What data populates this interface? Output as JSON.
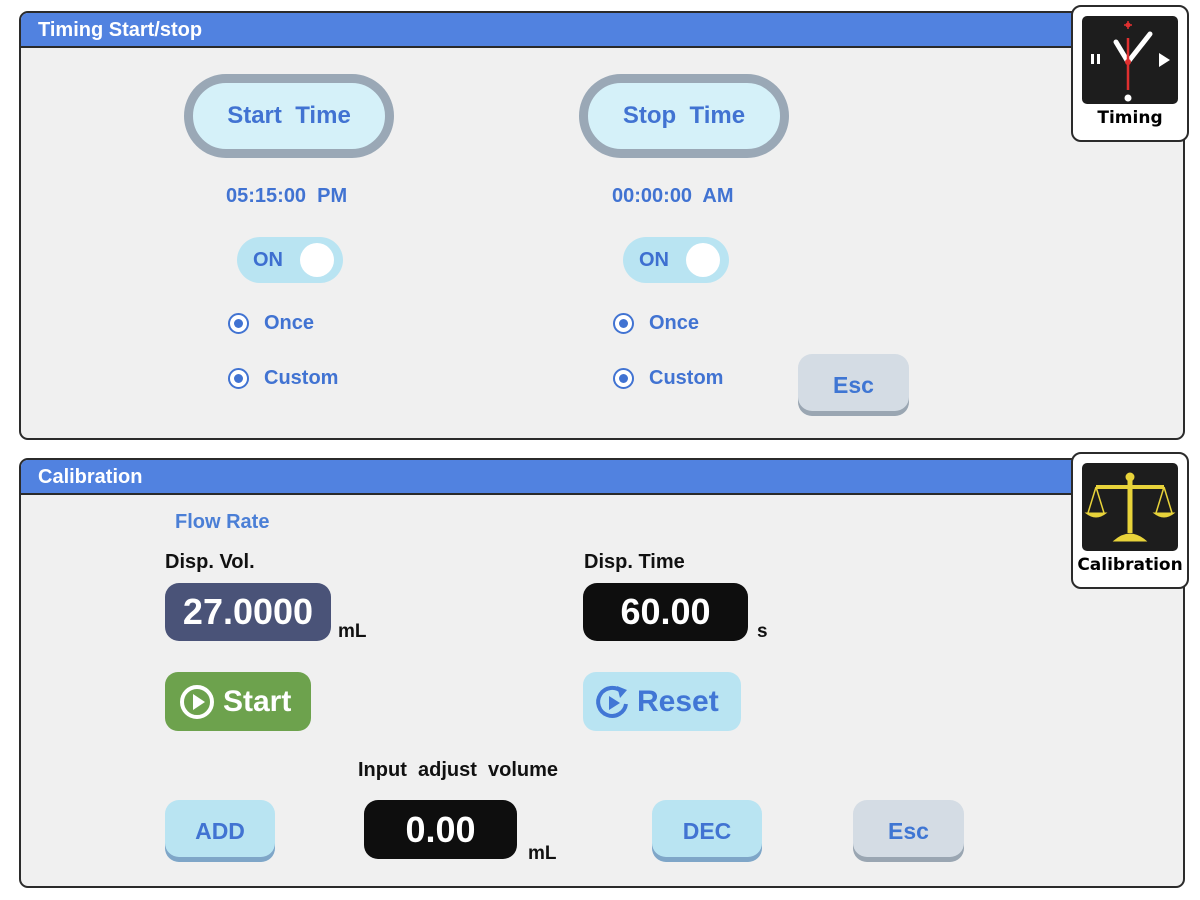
{
  "timing": {
    "title": "Timing Start/stop",
    "start": {
      "button_label": "Start  Time",
      "time": "05:15:00  PM",
      "toggle_label": "ON",
      "once_label": "Once",
      "custom_label": "Custom"
    },
    "stop": {
      "button_label": "Stop  Time",
      "time": "00:00:00  AM",
      "toggle_label": "ON",
      "once_label": "Once",
      "custom_label": "Custom"
    },
    "esc_label": "Esc",
    "side_card": {
      "caption": "Timing",
      "icon": "clock-icon"
    }
  },
  "calibration": {
    "title": "Calibration",
    "flow_rate_label": "Flow Rate",
    "disp_vol_label": "Disp. Vol.",
    "disp_vol_value": "27.0000",
    "disp_vol_unit": "mL",
    "disp_time_label": "Disp. Time",
    "disp_time_value": "60.00",
    "disp_time_unit": "s",
    "start_label": "Start",
    "reset_label": "Reset",
    "adjust_label": "Input  adjust  volume",
    "adjust_value": "0.00",
    "adjust_unit": "mL",
    "add_label": "ADD",
    "dec_label": "DEC",
    "esc_label": "Esc",
    "side_card": {
      "caption": "Calibration",
      "icon": "scale-icon"
    }
  },
  "colors": {
    "header_blue": "#5182e0",
    "accent_blue": "#4173d2",
    "start_green": "#6da24d",
    "vol_box": "#4a5378",
    "time_box": "#0e0e0e"
  }
}
